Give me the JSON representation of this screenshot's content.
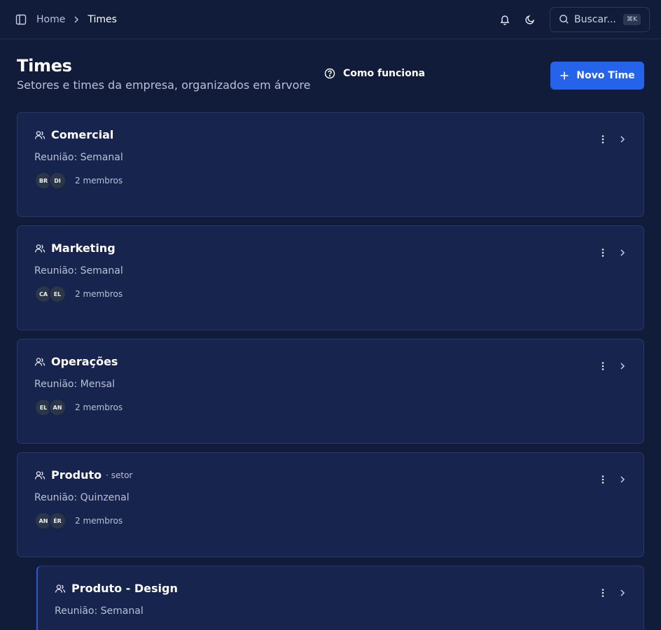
{
  "breadcrumb": {
    "home": "Home",
    "current": "Times"
  },
  "search": {
    "label": "Buscar...",
    "shortcut": "⌘K"
  },
  "header": {
    "title": "Times",
    "subtitle": "Setores e times da empresa, organizados em árvore",
    "how_label": "Como funciona",
    "new_label": "Novo Time"
  },
  "colors": {
    "background": "#111c3a",
    "card": "#17244d",
    "accent": "#2563eb"
  },
  "teams": [
    {
      "name": "Comercial",
      "tag": "",
      "meeting": "Reunião: Semanal",
      "members": [
        "BR",
        "DI"
      ],
      "member_count": "2 membros"
    },
    {
      "name": "Marketing",
      "tag": "",
      "meeting": "Reunião: Semanal",
      "members": [
        "CA",
        "EL"
      ],
      "member_count": "2 membros"
    },
    {
      "name": "Operações",
      "tag": "",
      "meeting": "Reunião: Mensal",
      "members": [
        "EL",
        "AN"
      ],
      "member_count": "2 membros"
    },
    {
      "name": "Produto",
      "tag": "· setor",
      "meeting": "Reunião: Quinzenal",
      "members": [
        "AN",
        "ÉR"
      ],
      "member_count": "2 membros"
    }
  ],
  "child_team": {
    "name": "Produto - Design",
    "meeting": "Reunião: Semanal"
  }
}
